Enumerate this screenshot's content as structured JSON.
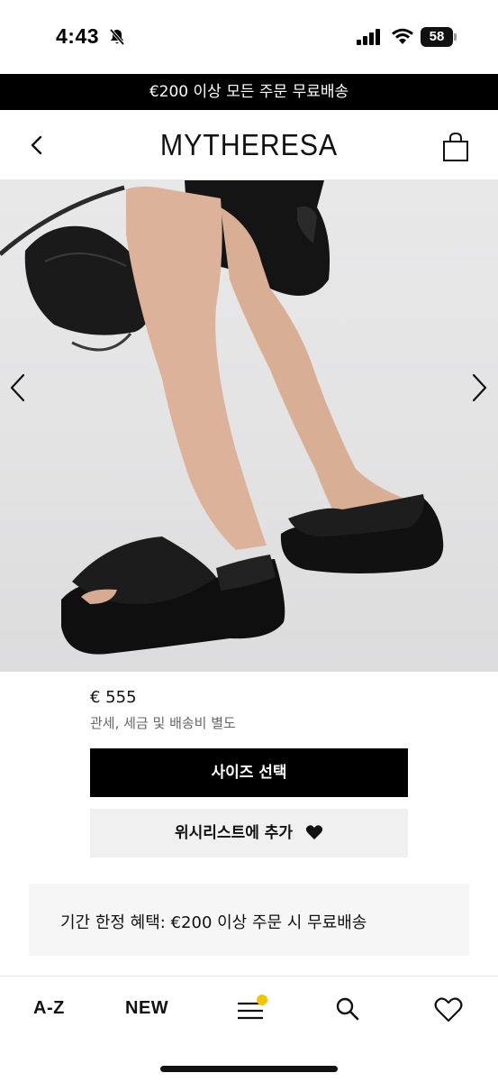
{
  "status_bar": {
    "time": "4:43",
    "battery": "58",
    "icons": [
      "bell-slash-icon",
      "signal-icon",
      "wifi-icon",
      "battery-icon"
    ]
  },
  "promo_banner": "€200 이상 모든 주문 무료배송",
  "header": {
    "logo": "MYTHERESA",
    "back_icon": "chevron-left-icon",
    "bag_icon": "shopping-bag-icon"
  },
  "gallery": {
    "prev_icon": "chevron-left-icon",
    "next_icon": "chevron-right-icon"
  },
  "product": {
    "price": "€ 555",
    "tax_note": "관세, 세금 및 배송비 별도"
  },
  "actions": {
    "size_select": "사이즈 선택",
    "wishlist": "위시리스트에 추가",
    "wishlist_icon": "heart-filled-icon"
  },
  "benefit": "기간 한정 혜택: €200 이상 주문 시 무료배송",
  "bottom_nav": {
    "az": "A-Z",
    "new": "NEW",
    "menu_icon": "hamburger-menu-icon",
    "search_icon": "search-icon",
    "wishlist_icon": "heart-outline-icon",
    "badge_color": "#f2c500"
  }
}
